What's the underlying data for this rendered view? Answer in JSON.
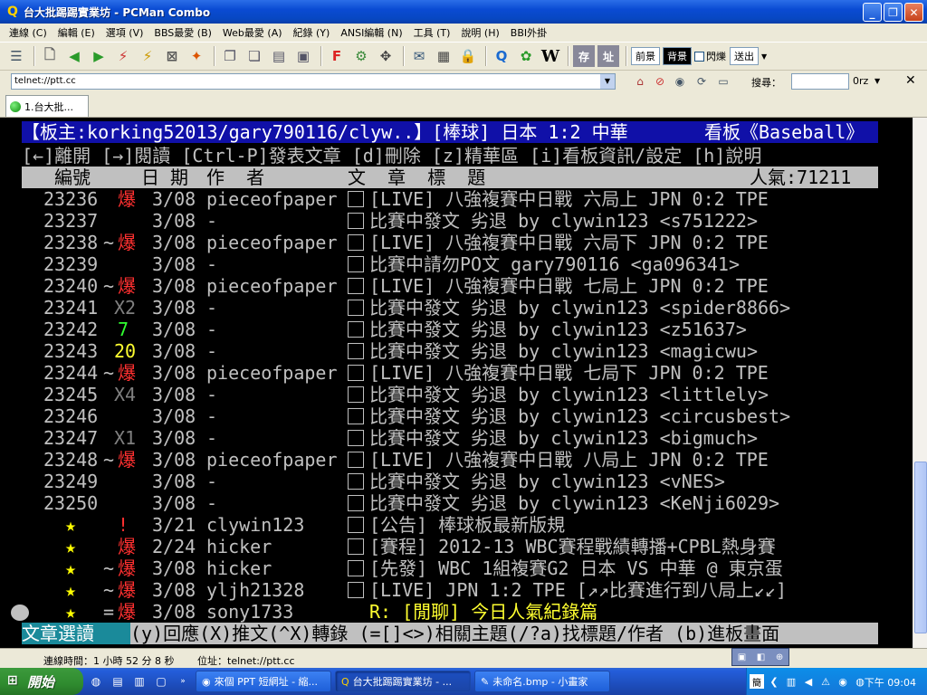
{
  "window": {
    "title": "台大批踢踢實業坊 - PCMan Combo"
  },
  "menu": [
    "連線 (C)",
    "編輯 (E)",
    "選項 (V)",
    "BBS最愛 (B)",
    "Web最愛 (A)",
    "紀錄 (Y)",
    "ANSI編輯 (N)",
    "工具 (T)",
    "說明 (H)",
    "BBI外掛"
  ],
  "toolbar": {
    "fg_label": "前景",
    "bg_label": "背景",
    "blink_label": "閃爍",
    "send_label": "送出"
  },
  "address": {
    "value": "telnet://ptt.cc"
  },
  "search": {
    "label": "搜尋：",
    "engine": "0rz"
  },
  "tabs": [
    {
      "label": "1.台大批..."
    }
  ],
  "terminal": {
    "header": {
      "title": "【板主:korking52013/gary790116/clyw..】[棒球] 日本 1:2 中華",
      "board": "看板《Baseball》"
    },
    "help_line": "[←]離開 [→]閱讀 [Ctrl-P]發表文章 [d]刪除 [z]精華區 [i]看板資訊/設定 [h]說明",
    "columns": {
      "num": "編號",
      "date": "日 期",
      "author": "作  者",
      "title": "文  章  標  題",
      "popularity": "人氣:71211"
    },
    "rows": [
      {
        "num": "23236",
        "mark": "",
        "recommend": "爆",
        "date": "3/08",
        "author": "pieceofpaper",
        "title": "[LIVE] 八強複賽中日戰 六局上 JPN 0:2 TPE"
      },
      {
        "num": "23237",
        "mark": "",
        "recommend": "",
        "date": "3/08",
        "author": "-",
        "title": "比賽中發文 劣退 by clywin123 <s751222>"
      },
      {
        "num": "23238",
        "mark": "~",
        "recommend": "爆",
        "date": "3/08",
        "author": "pieceofpaper",
        "title": "[LIVE] 八強複賽中日戰 六局下 JPN 0:2 TPE"
      },
      {
        "num": "23239",
        "mark": "",
        "recommend": "",
        "date": "3/08",
        "author": "-",
        "title": "比賽中請勿PO文 gary790116 <ga096341>"
      },
      {
        "num": "23240",
        "mark": "~",
        "recommend": "爆",
        "date": "3/08",
        "author": "pieceofpaper",
        "title": "[LIVE] 八強複賽中日戰 七局上 JPN 0:2 TPE"
      },
      {
        "num": "23241",
        "mark": "",
        "recommend": "X2",
        "date": "3/08",
        "author": "-",
        "title": "比賽中發文 劣退 by clywin123 <spider8866>"
      },
      {
        "num": "23242",
        "mark": "",
        "recommend": "7",
        "date": "3/08",
        "author": "-",
        "title": "比賽中發文 劣退 by clywin123 <z51637>"
      },
      {
        "num": "23243",
        "mark": "",
        "recommend": "20",
        "date": "3/08",
        "author": "-",
        "title": "比賽中發文 劣退 by clywin123 <magicwu>"
      },
      {
        "num": "23244",
        "mark": "~",
        "recommend": "爆",
        "date": "3/08",
        "author": "pieceofpaper",
        "title": "[LIVE] 八強複賽中日戰 七局下 JPN 0:2 TPE"
      },
      {
        "num": "23245",
        "mark": "",
        "recommend": "X4",
        "date": "3/08",
        "author": "-",
        "title": "比賽中發文 劣退 by clywin123 <littlely>"
      },
      {
        "num": "23246",
        "mark": "",
        "recommend": "",
        "date": "3/08",
        "author": "-",
        "title": "比賽中發文 劣退 by clywin123 <circusbest>"
      },
      {
        "num": "23247",
        "mark": "",
        "recommend": "X1",
        "date": "3/08",
        "author": "-",
        "title": "比賽中發文 劣退 by clywin123 <bigmuch>"
      },
      {
        "num": "23248",
        "mark": "~",
        "recommend": "爆",
        "date": "3/08",
        "author": "pieceofpaper",
        "title": "[LIVE] 八強複賽中日戰 八局上 JPN 0:2 TPE"
      },
      {
        "num": "23249",
        "mark": "",
        "recommend": "",
        "date": "3/08",
        "author": "-",
        "title": "比賽中發文 劣退 by clywin123 <vNES>"
      },
      {
        "num": "23250",
        "mark": "",
        "recommend": "",
        "date": "3/08",
        "author": "-",
        "title": "比賽中發文 劣退 by clywin123 <KeNji6029>"
      },
      {
        "num": "★",
        "mark": "",
        "recommend": "!",
        "date": "3/21",
        "author": "clywin123",
        "title": "[公告] 棒球板最新版規"
      },
      {
        "num": "★",
        "mark": "",
        "recommend": "爆",
        "date": "2/24",
        "author": "hicker",
        "title": "[賽程] 2012-13 WBC賽程戰績轉播+CPBL熱身賽"
      },
      {
        "num": "★",
        "mark": "~",
        "recommend": "爆",
        "date": "3/08",
        "author": "hicker",
        "title": "[先發] WBC 1組複賽G2 日本 VS 中華 @ 東京蛋"
      },
      {
        "num": "★",
        "mark": "~",
        "recommend": "爆",
        "date": "3/08",
        "author": "yljh21328",
        "title": "[LIVE] JPN 1:2 TPE [↗↗比賽進行到八局上↙↙]"
      },
      {
        "num": "★",
        "mark": "=",
        "recommend": "爆",
        "date": "3/08",
        "author": "sony1733",
        "title": "R: [閒聊] 今日人氣紀錄篇"
      }
    ],
    "footer": {
      "mode": "文章選讀",
      "keys": "(y)回應(X)推文(^X)轉錄 (=[]<>)相關主題(/?a)找標題/作者 (b)進板畫面"
    }
  },
  "status": {
    "connect_time": "連線時間：1 小時 52 分 8 秒",
    "address": "位址：telnet://ptt.cc"
  },
  "taskbar": {
    "start": "開始",
    "tasks": [
      {
        "label": "來個 PPT 短網址 - 縮..."
      },
      {
        "label": "台大批踢踢實業坊 - ..."
      },
      {
        "label": "未命名.bmp - 小畫家"
      }
    ],
    "ime": "簡",
    "clock": "下午 09:04"
  }
}
